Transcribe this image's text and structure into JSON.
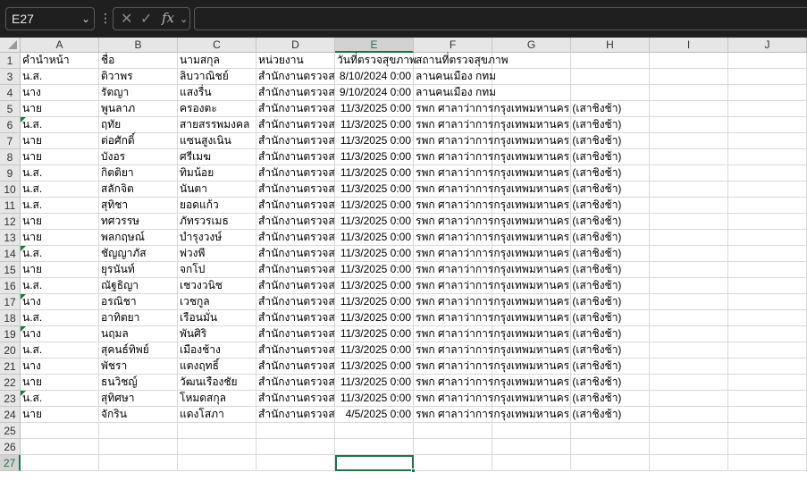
{
  "formula_bar": {
    "name_box": "E27",
    "formula": "",
    "cancel_icon": "x-icon",
    "enter_icon": "check-icon",
    "function_label": "fx"
  },
  "columns": [
    "A",
    "B",
    "C",
    "D",
    "E",
    "F",
    "G",
    "H",
    "I",
    "J"
  ],
  "selected_column": "E",
  "selected_row": "27",
  "row_numbers": [
    "1",
    "3",
    "4",
    "5",
    "6",
    "7",
    "8",
    "9",
    "10",
    "11",
    "12",
    "13",
    "14",
    "15",
    "16",
    "17",
    "18",
    "19",
    "20",
    "21",
    "22",
    "23",
    "24",
    "25",
    "26",
    "27"
  ],
  "rows": [
    [
      "คำนำหน้า",
      "ชื่อ",
      "นามสกุล",
      "หน่วยงาน",
      "วันที่ตรวจสุขภาพ",
      "สถานที่ตรวจสุขภาพ"
    ],
    [
      "น.ส.",
      "ติวาพร",
      "ลิบวาณิชย์",
      "สำนักงานตรวจส",
      "8/10/2024 0:00",
      "ลานคนเมือง กทม"
    ],
    [
      "นาง",
      "รัตญา",
      "แสงรื่น",
      "สำนักงานตรวจส",
      "9/10/2024 0:00",
      "ลานคนเมือง กทม"
    ],
    [
      "นาย",
      "พูนลาภ",
      "ครองตะ",
      "สำนักงานตรวจส",
      "11/3/2025 0:00",
      "รพก ศาลาว่าการกรุงเทพมหานคร (เสาชิงช้า)"
    ],
    [
      "น.ส.",
      "ฤทัย",
      "สายสรรพมงคล",
      "สำนักงานตรวจส",
      "11/3/2025 0:00",
      "รพก ศาลาว่าการกรุงเทพมหานคร (เสาชิงช้า)"
    ],
    [
      "นาย",
      "ต่อศักดิ์",
      "แซนสูงเนิน",
      "สำนักงานตรวจส",
      "11/3/2025 0:00",
      "รพก ศาลาว่าการกรุงเทพมหานคร (เสาชิงช้า)"
    ],
    [
      "นาย",
      "บังอร",
      "ศรีเมฆ",
      "สำนักงานตรวจส",
      "11/3/2025 0:00",
      "รพก ศาลาว่าการกรุงเทพมหานคร (เสาชิงช้า)"
    ],
    [
      "น.ส.",
      "กิตติยา",
      "ทิมน้อย",
      "สำนักงานตรวจส",
      "11/3/2025 0:00",
      "รพก ศาลาว่าการกรุงเทพมหานคร (เสาชิงช้า)"
    ],
    [
      "น.ส.",
      "สลักจิต",
      "นันตา",
      "สำนักงานตรวจส",
      "11/3/2025 0:00",
      "รพก ศาลาว่าการกรุงเทพมหานคร (เสาชิงช้า)"
    ],
    [
      "น.ส.",
      "สุทิชา",
      "ยอดแก้ว",
      "สำนักงานตรวจส",
      "11/3/2025 0:00",
      "รพก ศาลาว่าการกรุงเทพมหานคร (เสาชิงช้า)"
    ],
    [
      "นาย",
      "ทศวรรษ",
      "ภัทรวรเมธ",
      "สำนักงานตรวจส",
      "11/3/2025 0:00",
      "รพก ศาลาว่าการกรุงเทพมหานคร (เสาชิงช้า)"
    ],
    [
      "นาย",
      "พลกฤษณ์",
      "บำรุงวงษ์",
      "สำนักงานตรวจส",
      "11/3/2025 0:00",
      "รพก ศาลาว่าการกรุงเทพมหานคร (เสาชิงช้า)"
    ],
    [
      "น.ส.",
      "ชัญญาภัส",
      "พ่วงพี",
      "สำนักงานตรวจส",
      "11/3/2025 0:00",
      "รพก ศาลาว่าการกรุงเทพมหานคร (เสาชิงช้า)"
    ],
    [
      "นาย",
      "ยุรนันท์",
      "จกโป",
      "สำนักงานตรวจส",
      "11/3/2025 0:00",
      "รพก ศาลาว่าการกรุงเทพมหานคร (เสาชิงช้า)"
    ],
    [
      "น.ส.",
      "ณัฐธิญา",
      "เชวงวนิช",
      "สำนักงานตรวจส",
      "11/3/2025 0:00",
      "รพก ศาลาว่าการกรุงเทพมหานคร (เสาชิงช้า)"
    ],
    [
      "นาง",
      "อรณิชา",
      "เวชกูล",
      "สำนักงานตรวจส",
      "11/3/2025 0:00",
      "รพก ศาลาว่าการกรุงเทพมหานคร (เสาชิงช้า)"
    ],
    [
      "น.ส.",
      "อาทิตยา",
      "เรือนมั่น",
      "สำนักงานตรวจส",
      "11/3/2025 0:00",
      "รพก ศาลาว่าการกรุงเทพมหานคร (เสาชิงช้า)"
    ],
    [
      "นาง",
      "นฤมล",
      "พันศิริ",
      "สำนักงานตรวจส",
      "11/3/2025 0:00",
      "รพก ศาลาว่าการกรุงเทพมหานคร (เสาชิงช้า)"
    ],
    [
      "น.ส.",
      "สุคนธ์ทิพย์",
      "เมืองช้าง",
      "สำนักงานตรวจส",
      "11/3/2025 0:00",
      "รพก ศาลาว่าการกรุงเทพมหานคร (เสาชิงช้า)"
    ],
    [
      "นาง",
      "พัชรา",
      "แตงฤทธิ์",
      "สำนักงานตรวจส",
      "11/3/2025 0:00",
      "รพก ศาลาว่าการกรุงเทพมหานคร (เสาชิงช้า)"
    ],
    [
      "นาย",
      "ธนวิชญ์",
      "วัฒนเรืองชัย",
      "สำนักงานตรวจส",
      "11/3/2025 0:00",
      "รพก ศาลาว่าการกรุงเทพมหานคร (เสาชิงช้า)"
    ],
    [
      "น.ส.",
      "สุทิศษา",
      "โหมดสกุล",
      "สำนักงานตรวจส",
      "11/3/2025 0:00",
      "รพก ศาลาว่าการกรุงเทพมหานคร (เสาชิงช้า)"
    ],
    [
      "นาย",
      "จักริน",
      "แดงโสภา",
      "สำนักงานตรวจส",
      "4/5/2025 0:00",
      "รพก ศาลาว่าการกรุงเทพมหานคร (เสาชิงช้า)"
    ],
    [
      "",
      "",
      "",
      "",
      "",
      ""
    ],
    [
      "",
      "",
      "",
      "",
      "",
      ""
    ],
    [
      "",
      "",
      "",
      "",
      "",
      ""
    ]
  ],
  "error_indicator_rows": [
    "6",
    "14",
    "17",
    "19",
    "23"
  ],
  "colors": {
    "accent": "#217346",
    "header_bg": "#e6e6e6",
    "gridline": "#d9d9d9",
    "error_flag": "#1e7a3c"
  }
}
